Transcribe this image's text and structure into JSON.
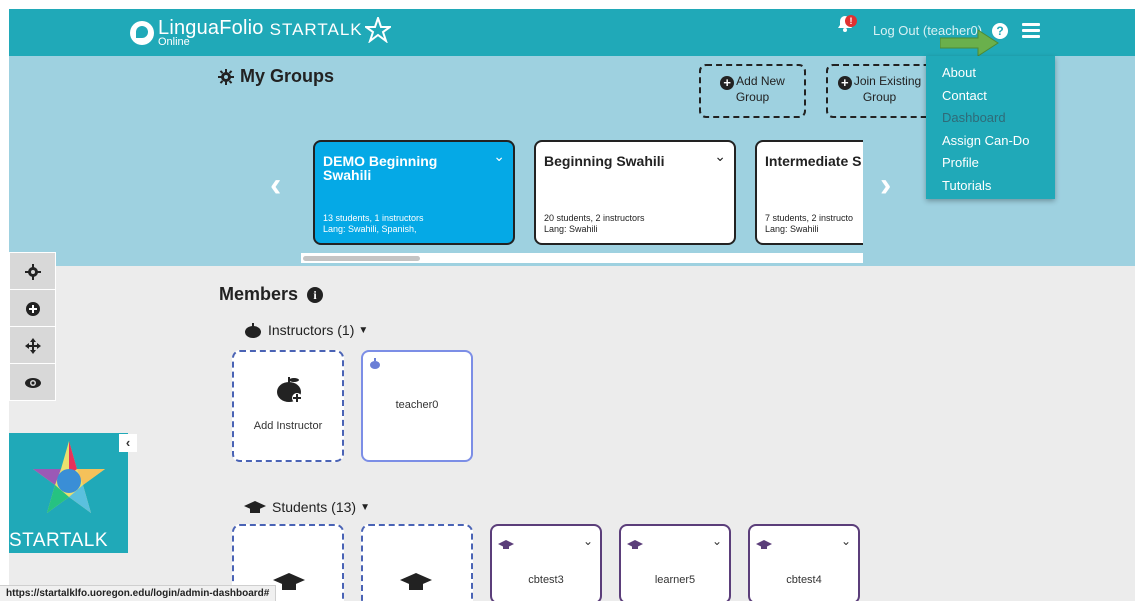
{
  "navbar": {
    "logo_main": "LinguaFolio",
    "logo_sub": "Online",
    "logo_startalk": "STARTALK",
    "bell_badge": "!",
    "logout_label": "Log Out (teacher0)",
    "help_icon": "?",
    "brand_color": "#20a9b8"
  },
  "menu": {
    "items": [
      "About",
      "Contact",
      "Dashboard",
      "Assign Can-Do",
      "Profile",
      "Tutorials"
    ]
  },
  "groups": {
    "title": "My Groups",
    "add_new": [
      "Add New",
      "Group"
    ],
    "join_existing": [
      "Join Existing",
      "Group"
    ],
    "prev_arrow": "‹",
    "next_arrow": "›",
    "cards": [
      {
        "name": "DEMO Beginning Swahili",
        "meta1": "13 students, 1 instructors",
        "meta2": "Lang: Swahili, Spanish,",
        "active": true
      },
      {
        "name": "Beginning Swahili",
        "meta1": "20 students, 2 instructors",
        "meta2": "Lang: Swahili",
        "active": false
      },
      {
        "name": "Intermediate S",
        "meta1": "7 students, 2 instructo",
        "meta2": "Lang: Swahili",
        "active": false
      }
    ]
  },
  "members": {
    "title": "Members",
    "info_icon": "i",
    "instructors_heading": "Instructors (1)",
    "add_instructor": "Add Instructor",
    "instructor_name": "teacher0",
    "students_heading": "Students (13)",
    "students": [
      "cbtest3",
      "learner5",
      "cbtest4"
    ]
  },
  "startalk_logo": {
    "collapse": "‹",
    "text": "STARTALK"
  },
  "status_bar": {
    "url": "https://startalklfo.uoregon.edu/login/admin-dashboard#"
  }
}
